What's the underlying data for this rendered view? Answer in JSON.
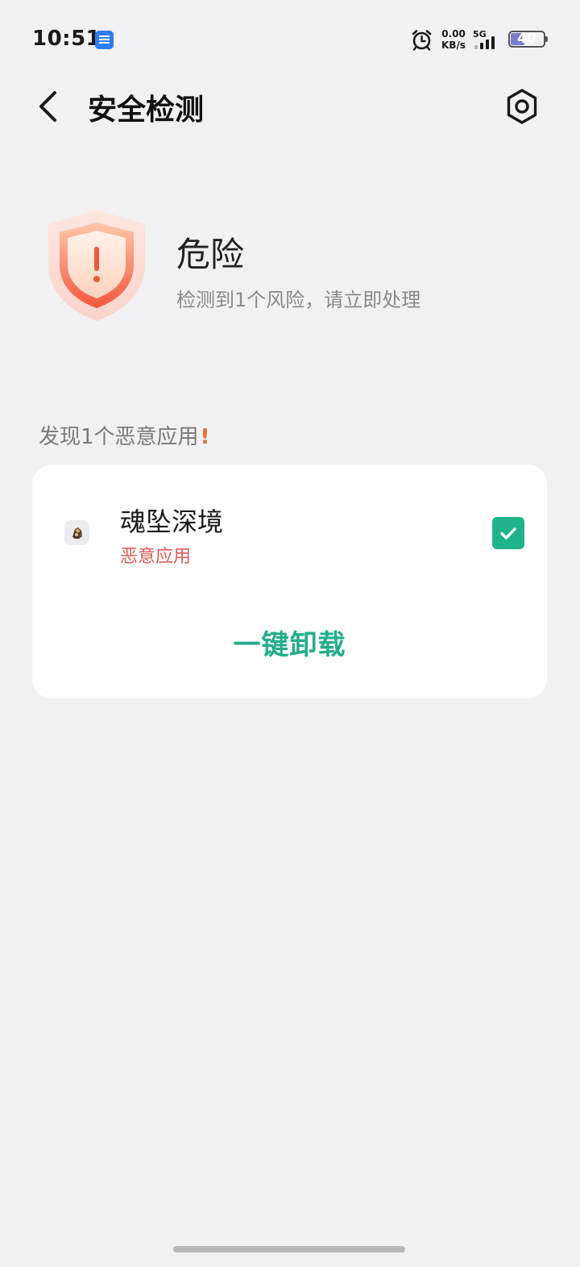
{
  "status_bar": {
    "time": "10:51",
    "net_speed_value": "0.00",
    "net_speed_unit": "KB/s",
    "network_type": "5G",
    "battery_level": "40",
    "battery_fraction": 0.4,
    "app_icon_color": "#2f7cf6"
  },
  "header": {
    "title": "安全检测",
    "back_icon": "chevron-left-icon",
    "settings_icon": "gear-icon"
  },
  "risk": {
    "level": "危险",
    "summary": "检测到1个风险，请立即处理",
    "shield_icon": "shield-alert-icon",
    "accent_color": "#f06b3a"
  },
  "section": {
    "title": "发现1个恶意应用",
    "alert_mark": "!"
  },
  "apps": [
    {
      "name": "魂坠深境",
      "tag": "恶意应用",
      "checked": true,
      "tag_color": "#e25b55"
    }
  ],
  "actions": {
    "uninstall_label": "一键卸载",
    "accent_color": "#23ad8a"
  }
}
